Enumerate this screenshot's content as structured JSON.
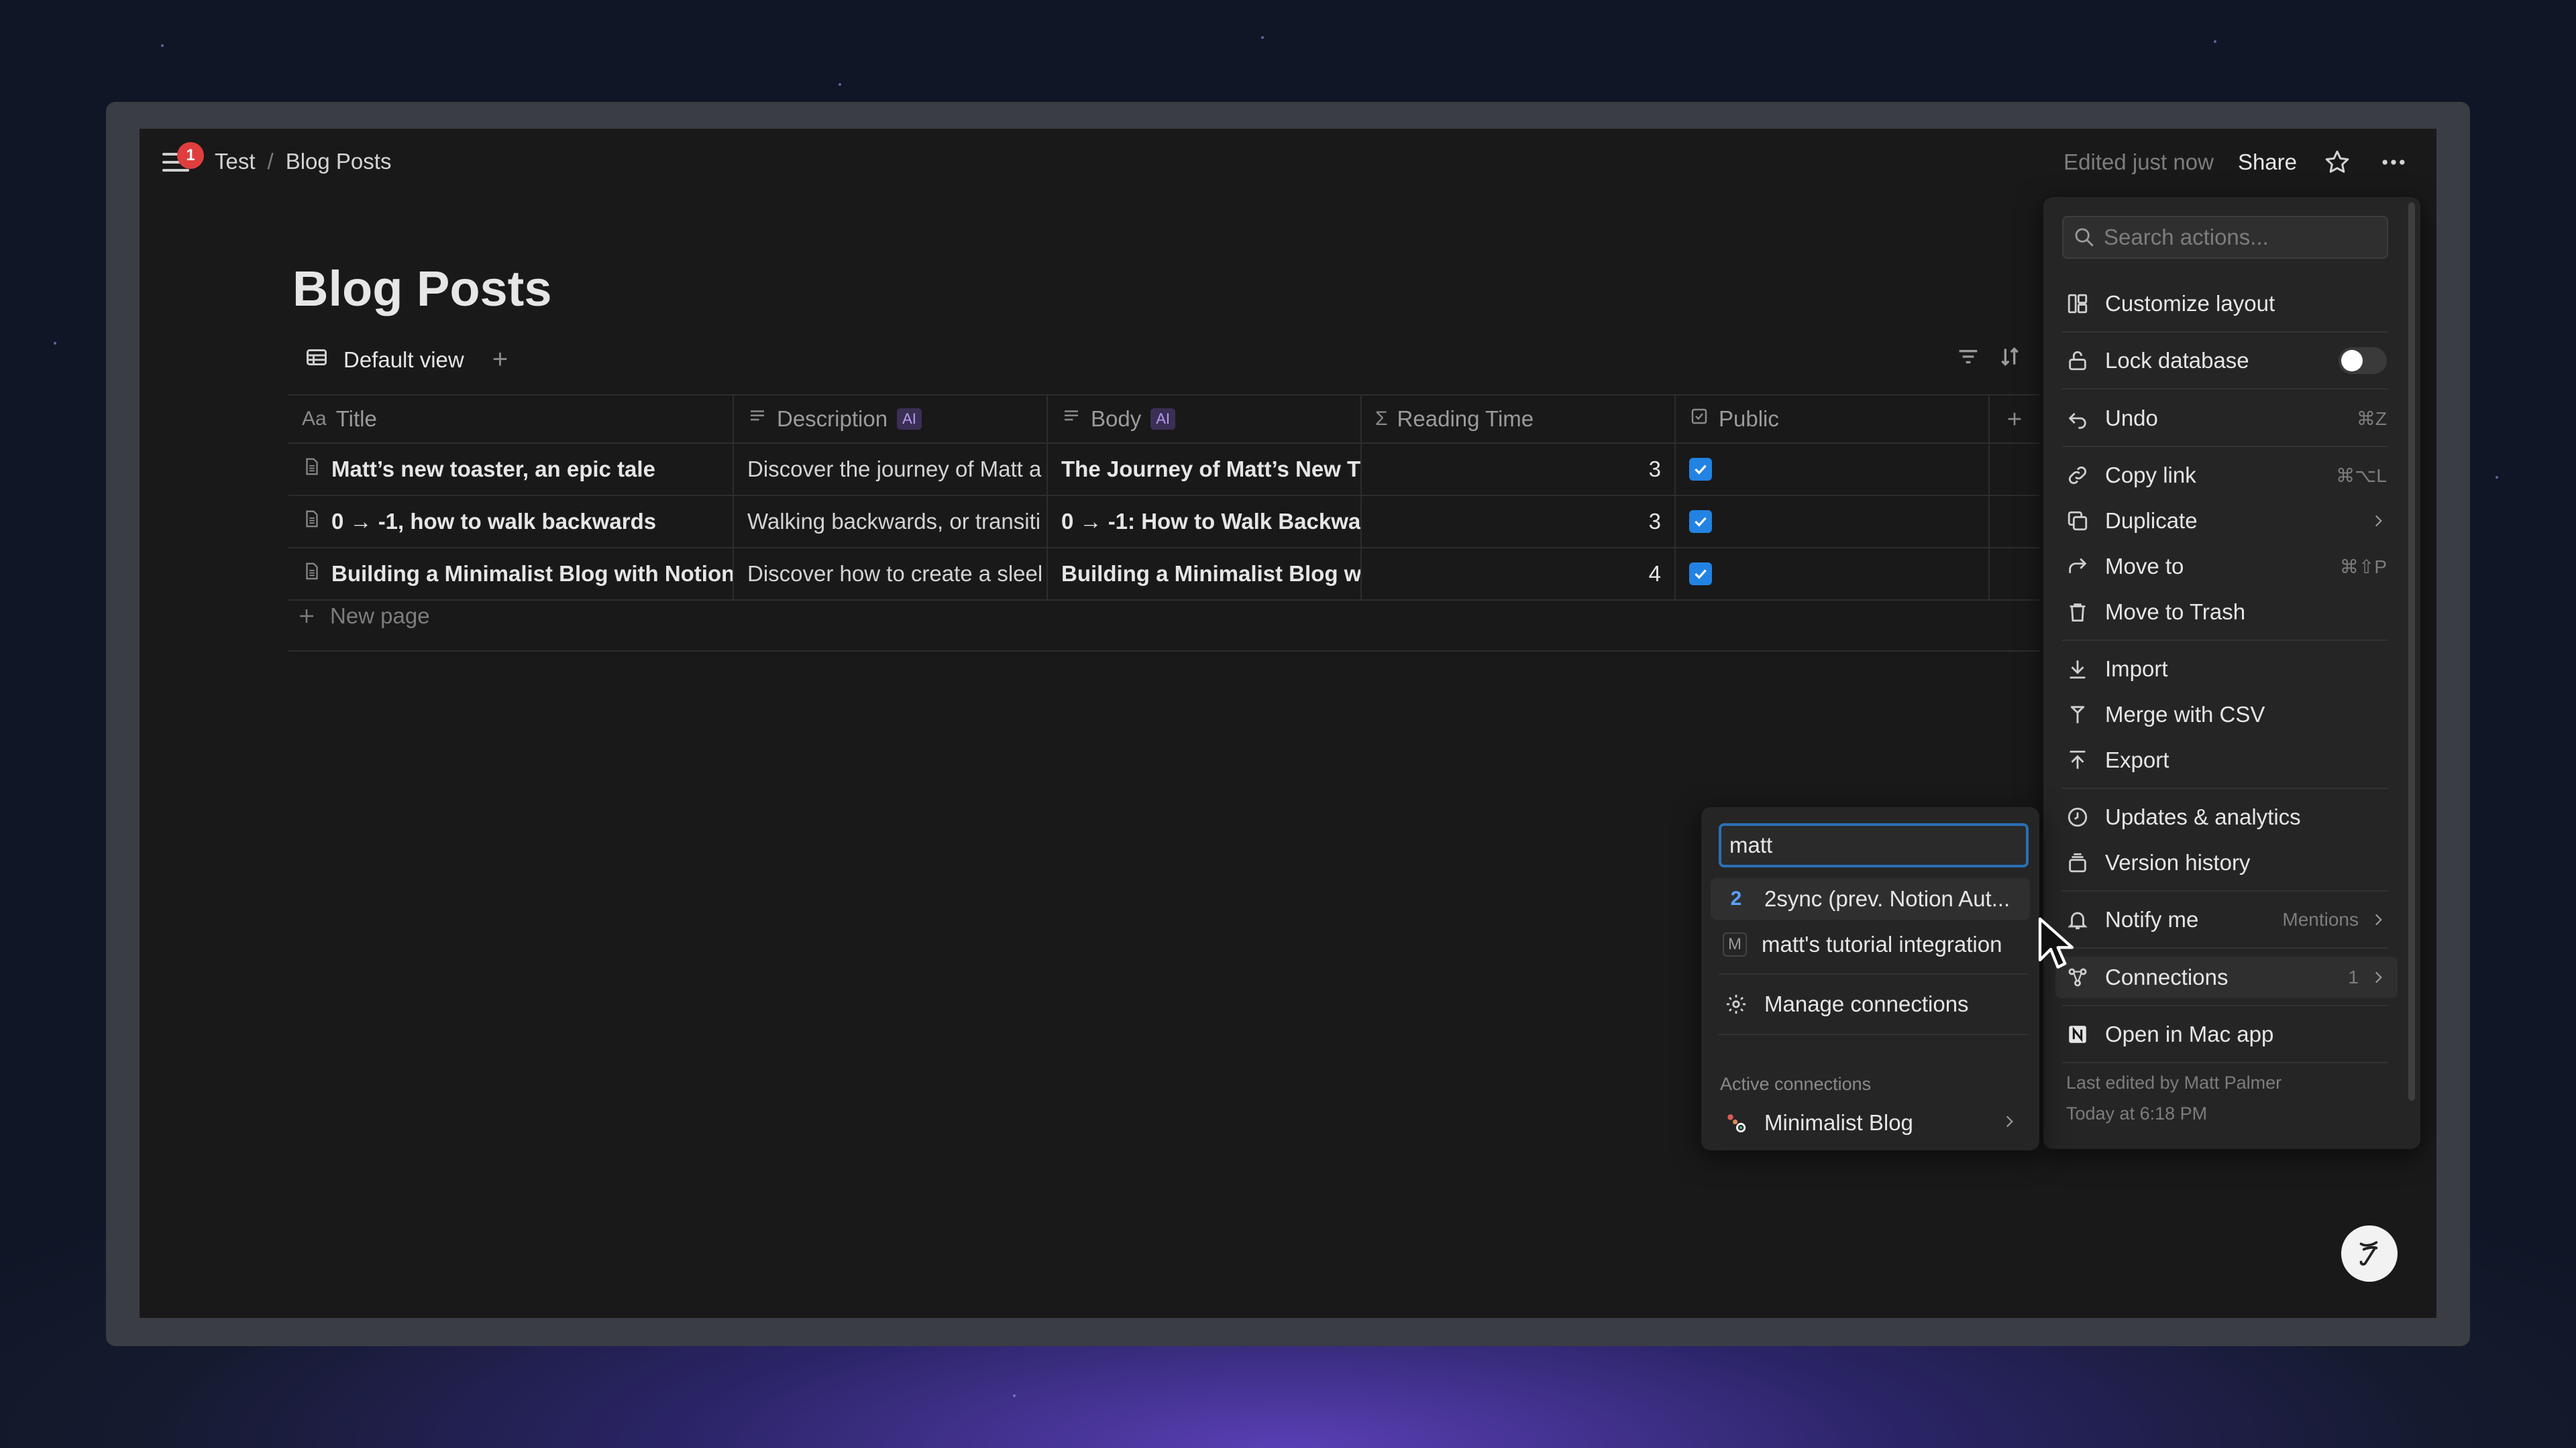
{
  "topbar": {
    "notification_count": "1",
    "breadcrumb": [
      "Test",
      "Blog Posts"
    ],
    "breadcrumb_separator": "/",
    "edited_label": "Edited just now",
    "share_label": "Share"
  },
  "page": {
    "title": "Blog Posts",
    "view_label": "Default view",
    "new_page_label": "New page"
  },
  "table": {
    "columns": [
      {
        "icon": "Aa",
        "label": "Title",
        "ai": false
      },
      {
        "icon": "text-icon",
        "label": "Description",
        "ai": true
      },
      {
        "icon": "text-icon",
        "label": "Body",
        "ai": true
      },
      {
        "icon": "Σ",
        "label": "Reading Time",
        "ai": false
      },
      {
        "icon": "checkbox-icon",
        "label": "Public",
        "ai": false
      }
    ],
    "ai_tag": "AI",
    "rows": [
      {
        "title": "Matt’s new toaster, an epic tale",
        "description": "Discover the journey of Matt a",
        "body": "The Journey of Matt’s New T",
        "reading_time": "3",
        "public": true
      },
      {
        "title": "0 → -1, how to walk backwards",
        "description": "Walking backwards, or transiti",
        "body": "0 → -1: How to Walk Backwa",
        "reading_time": "3",
        "public": true
      },
      {
        "title": "Building a Minimalist Blog with Notion",
        "description": "Discover how to create a sleel",
        "body": "Building a Minimalist Blog wi",
        "reading_time": "4",
        "public": true
      }
    ]
  },
  "action_menu": {
    "search_placeholder": "Search actions...",
    "items": [
      {
        "label": "Customize layout"
      },
      {
        "label": "Lock database"
      },
      {
        "label": "Undo",
        "shortcut": "⌘Z"
      },
      {
        "label": "Copy link",
        "shortcut": "⌘⌥L"
      },
      {
        "label": "Duplicate"
      },
      {
        "label": "Move to",
        "shortcut": "⌘⇧P"
      },
      {
        "label": "Move to Trash"
      },
      {
        "label": "Import"
      },
      {
        "label": "Merge with CSV"
      },
      {
        "label": "Export"
      },
      {
        "label": "Updates & analytics"
      },
      {
        "label": "Version history"
      },
      {
        "label": "Notify me",
        "value": "Mentions"
      },
      {
        "label": "Connections",
        "value": "1"
      },
      {
        "label": "Open in Mac app"
      }
    ],
    "footer_line1": "Last edited by Matt Palmer",
    "footer_line2": "Today at 6:18 PM"
  },
  "connections_menu": {
    "search_value": "matt",
    "results": [
      {
        "icon_text": "2",
        "label": "2sync (prev. Notion Aut..."
      },
      {
        "icon_text": "M",
        "label": "matt's tutorial integration"
      }
    ],
    "manage_label": "Manage connections",
    "active_heading": "Active connections",
    "active": [
      {
        "label": "Minimalist Blog"
      }
    ]
  },
  "colors": {
    "accent": "#2383e2",
    "badge": "#e03e3e",
    "background": "#191919",
    "menu": "#252525"
  }
}
